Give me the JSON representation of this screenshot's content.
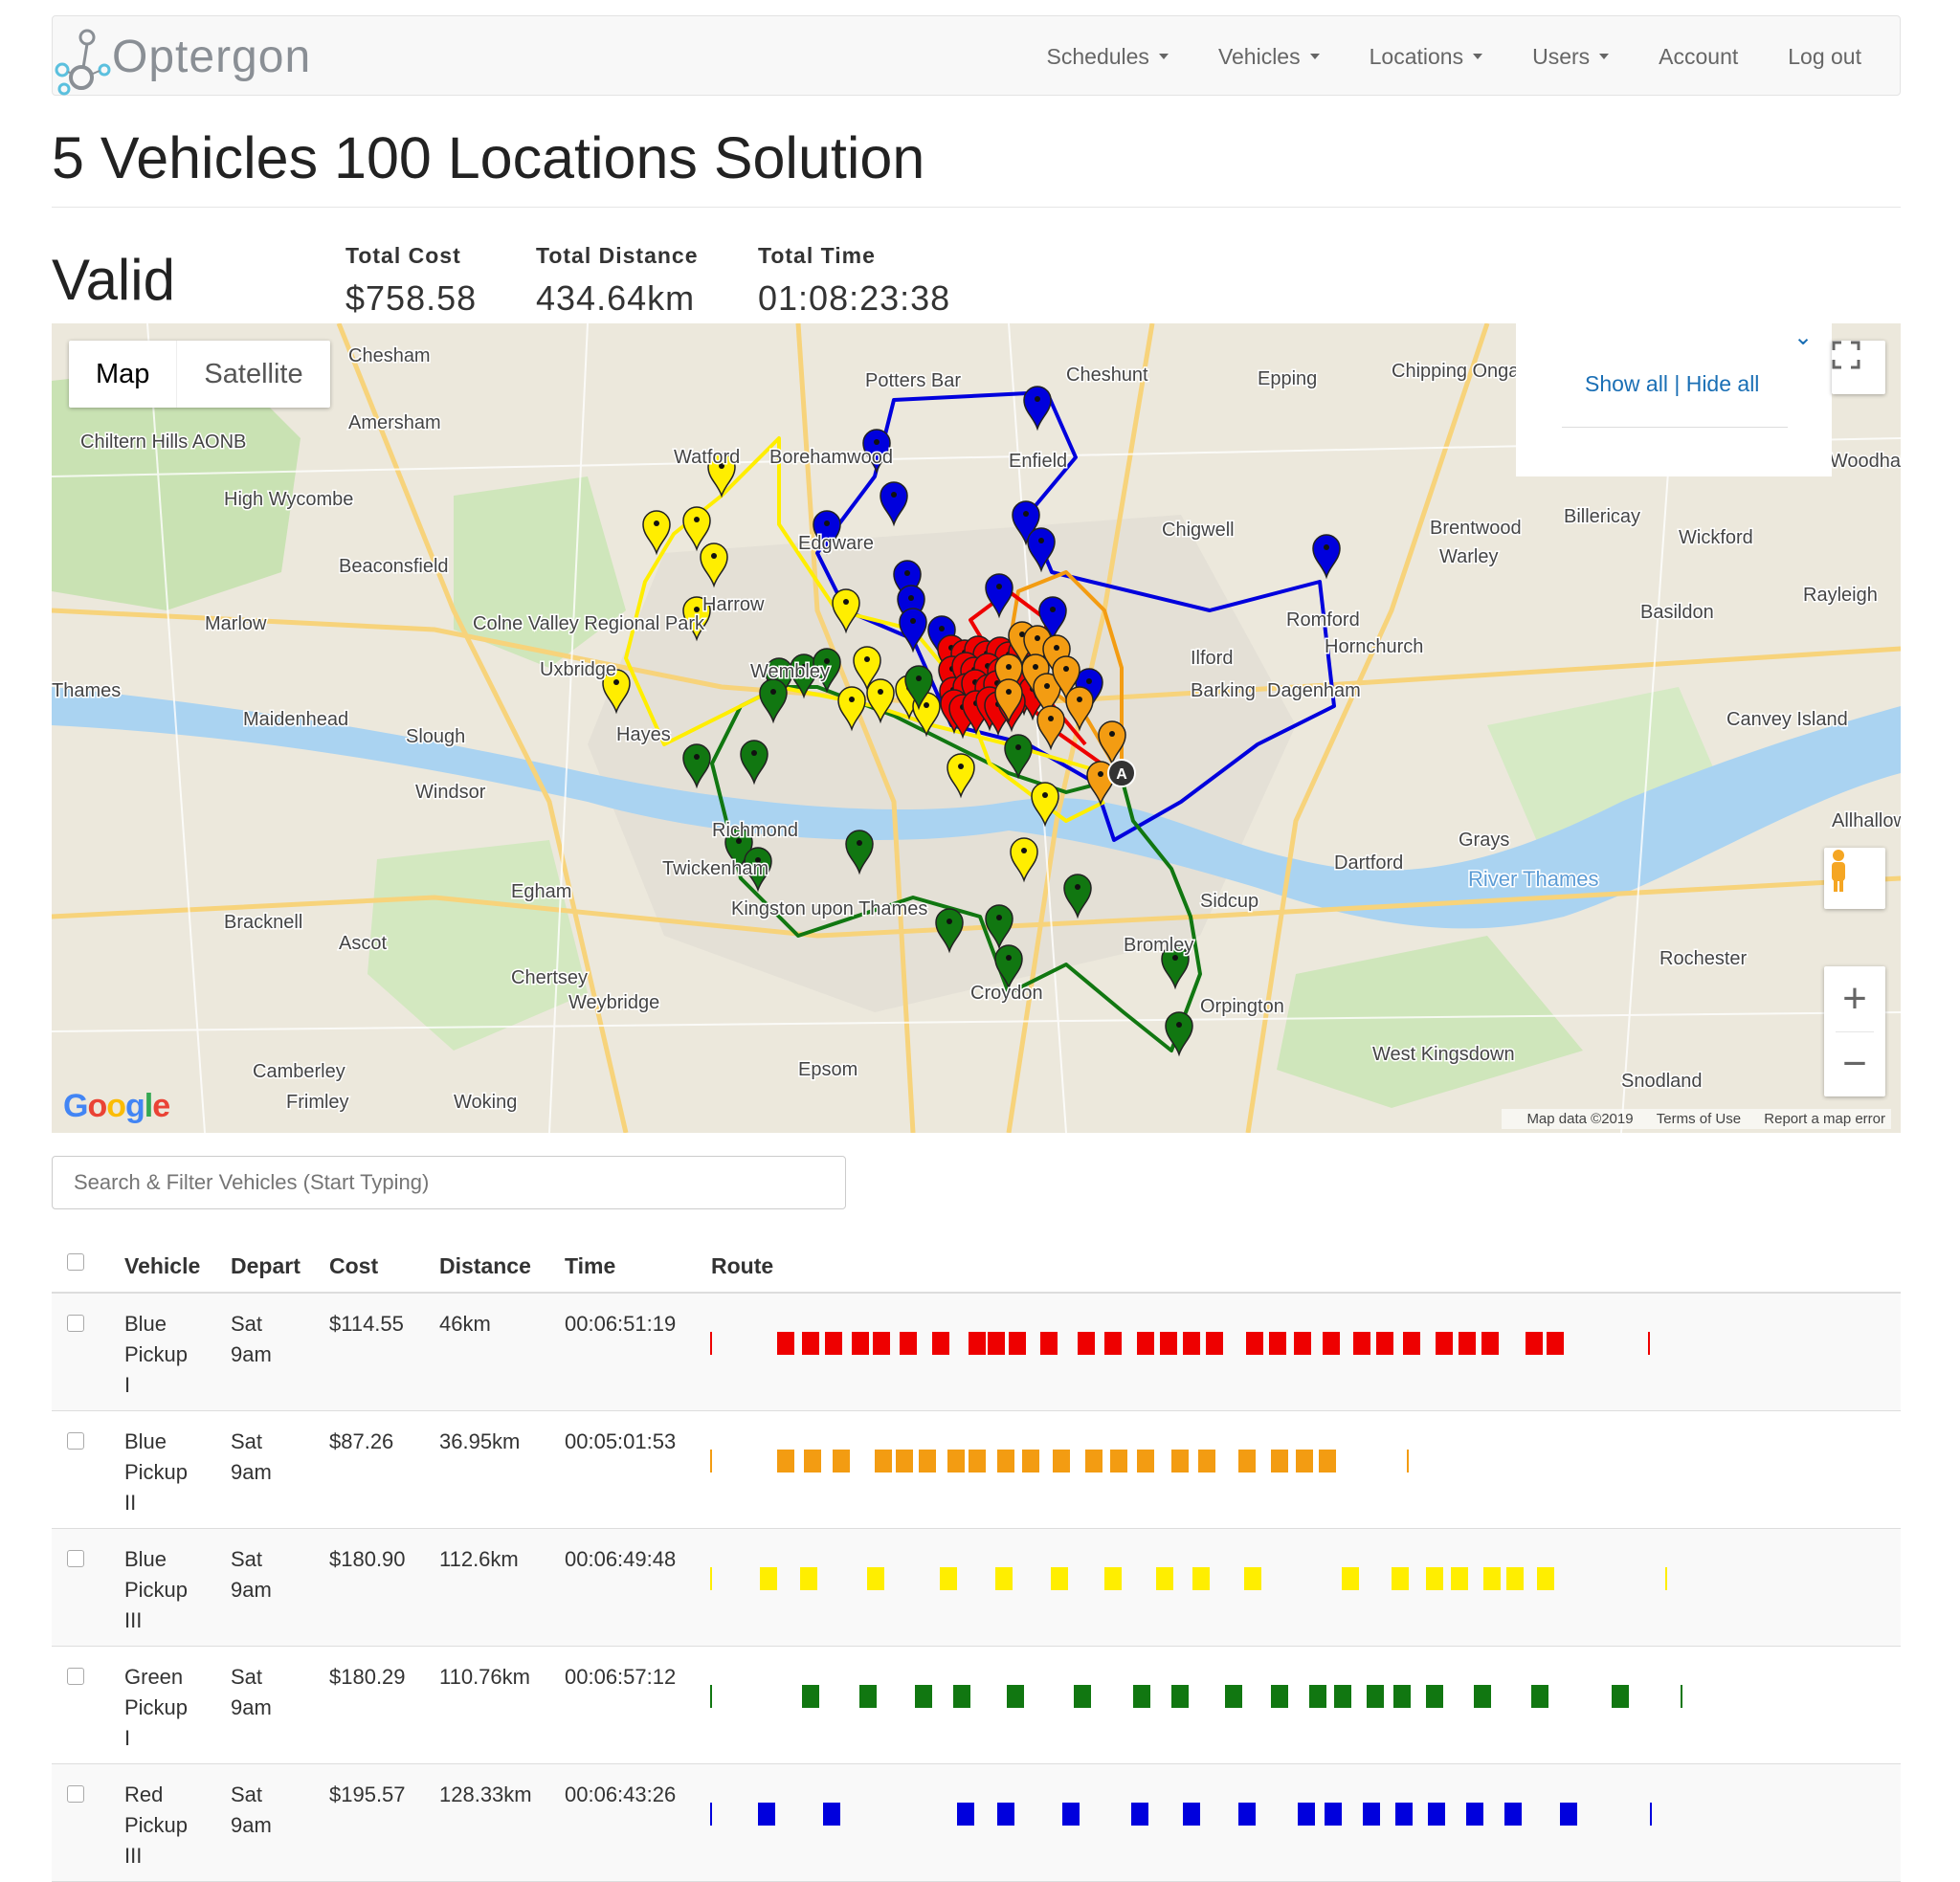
{
  "brand": {
    "name": "Optergon"
  },
  "nav": [
    {
      "label": "Schedules",
      "dropdown": true
    },
    {
      "label": "Vehicles",
      "dropdown": true
    },
    {
      "label": "Locations",
      "dropdown": true
    },
    {
      "label": "Users",
      "dropdown": true
    },
    {
      "label": "Account",
      "dropdown": false
    },
    {
      "label": "Log out",
      "dropdown": false
    }
  ],
  "page": {
    "title": "5 Vehicles 100 Locations Solution"
  },
  "summary": {
    "status": "Valid",
    "total_cost_label": "Total Cost",
    "total_cost": "$758.58",
    "total_distance_label": "Total Distance",
    "total_distance": "434.64km",
    "total_time_label": "Total Time",
    "total_time": "01:08:23:38"
  },
  "map": {
    "type_map": "Map",
    "type_satellite": "Satellite",
    "show_all": "Show all",
    "hide_all": "Hide all",
    "separator": "|",
    "footer_data": "Map data ©2019",
    "footer_terms": "Terms of Use",
    "footer_report": "Report a map error",
    "google": "Google",
    "places": [
      "Chesham",
      "Amersham",
      "Chiltern Hills AONB",
      "High Wycombe",
      "Beaconsfield",
      "Marlow",
      "Maidenhead",
      "Slough",
      "Windsor",
      "Bracknell",
      "Ascot",
      "Egham",
      "Chertsey",
      "Weybridge",
      "Camberley",
      "Frimley",
      "Woking",
      "Epsom",
      "Watford",
      "Borehamwood",
      "Potters Bar",
      "Cheshunt",
      "Epping",
      "Chipping Ongar",
      "Enfield",
      "Edgware",
      "Harrow",
      "Wembley",
      "Hayes",
      "Uxbridge",
      "Colne Valley Regional Park",
      "Richmond",
      "Twickenham",
      "Kingston upon Thames",
      "Croydon",
      "Bromley",
      "Orpington",
      "Sidcup",
      "Dartford",
      "Grays",
      "Ilford",
      "Barking",
      "Dagenham",
      "Romford",
      "Hornchurch",
      "Chigwell",
      "Brentwood",
      "Warley",
      "Billericay",
      "Wickford",
      "Basildon",
      "Rayleigh",
      "Canvey Island",
      "Allhallows",
      "Rochester",
      "West Kingsdown",
      "Snodland",
      "South Woodham Ferrers",
      "River Thames",
      "Thames"
    ],
    "colors": {
      "red": "#ee0000",
      "orange": "#f39c12",
      "yellow": "#ffee00",
      "green": "#117711",
      "blue": "#0000dd"
    }
  },
  "search": {
    "placeholder": "Search & Filter Vehicles (Start Typing)"
  },
  "table": {
    "headers": {
      "vehicle": "Vehicle",
      "depart": "Depart",
      "cost": "Cost",
      "distance": "Distance",
      "time": "Time",
      "route": "Route"
    },
    "rows": [
      {
        "vehicle": [
          "Blue",
          "Pickup",
          "I"
        ],
        "depart": [
          "Sat",
          "9am"
        ],
        "cost": "$114.55",
        "distance": "46km",
        "time": "00:06:51:19",
        "color": "#ee0000"
      },
      {
        "vehicle": [
          "Blue",
          "Pickup",
          "II"
        ],
        "depart": [
          "Sat",
          "9am"
        ],
        "cost": "$87.26",
        "distance": "36.95km",
        "time": "00:05:01:53",
        "color": "#f39c12"
      },
      {
        "vehicle": [
          "Blue",
          "Pickup",
          "III"
        ],
        "depart": [
          "Sat",
          "9am"
        ],
        "cost": "$180.90",
        "distance": "112.6km",
        "time": "00:06:49:48",
        "color": "#ffee00"
      },
      {
        "vehicle": [
          "Green",
          "Pickup",
          "I"
        ],
        "depart": [
          "Sat",
          "9am"
        ],
        "cost": "$180.29",
        "distance": "110.76km",
        "time": "00:06:57:12",
        "color": "#117711"
      },
      {
        "vehicle": [
          "Red",
          "Pickup",
          "III"
        ],
        "depart": [
          "Sat",
          "9am"
        ],
        "cost": "$195.57",
        "distance": "128.33km",
        "time": "00:06:43:26",
        "color": "#0000dd"
      }
    ]
  }
}
